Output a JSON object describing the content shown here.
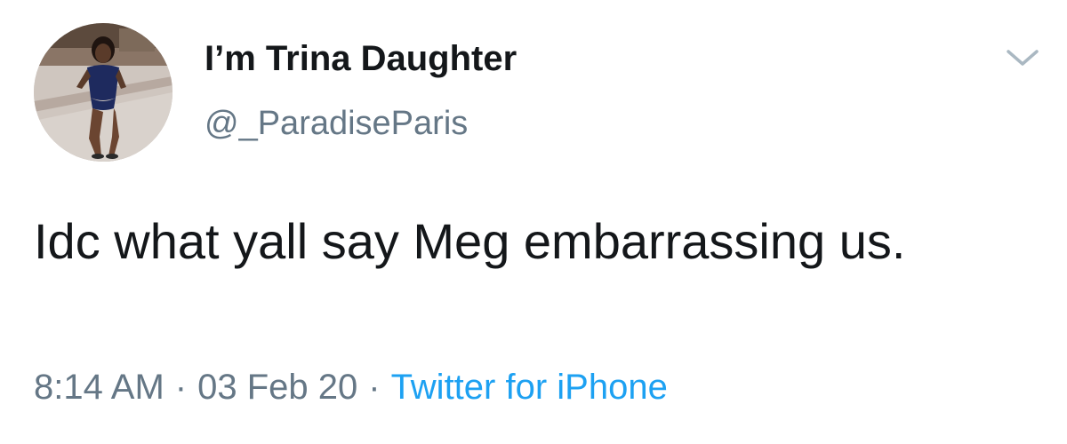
{
  "author": {
    "display_name": "I’m Trina Daughter",
    "handle": "@_ParadiseParis"
  },
  "tweet": {
    "text": "Idc what yall say Meg embarrassing us."
  },
  "meta": {
    "time": "8:14 AM",
    "separator": "·",
    "date": "03 Feb 20",
    "source": "Twitter for iPhone"
  },
  "icons": {
    "menu": "chevron-down-icon",
    "avatar": "avatar-photo"
  },
  "colors": {
    "name": "#14171a",
    "secondary": "#657786",
    "link": "#1da1f2",
    "background": "#ffffff"
  }
}
